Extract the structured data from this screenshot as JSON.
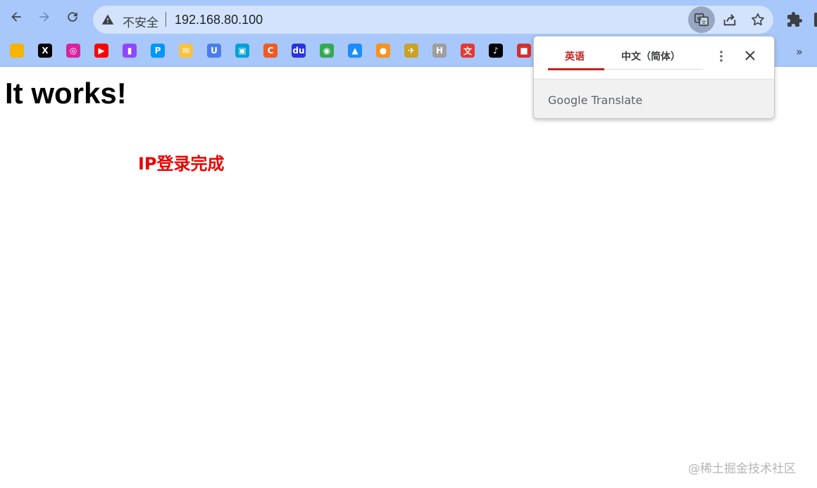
{
  "browser": {
    "security_label": "不安全",
    "url": "192.168.80.100",
    "bookmarks": [
      {
        "icon": "rainbow-bookmark-icon",
        "glyph": "",
        "color": "#f4b400"
      },
      {
        "icon": "x-twitter-bookmark-icon",
        "glyph": "X",
        "color": "#000000"
      },
      {
        "icon": "instagram-bookmark-icon",
        "glyph": "◎",
        "color": "#d6249f"
      },
      {
        "icon": "youtube-bookmark-icon",
        "glyph": "▶",
        "color": "#ff0000"
      },
      {
        "icon": "twitch-bookmark-icon",
        "glyph": "▮",
        "color": "#9146ff"
      },
      {
        "icon": "pixiv-bookmark-icon",
        "glyph": "P",
        "color": "#0096fa"
      },
      {
        "icon": "mail-bookmark-icon",
        "glyph": "✉",
        "color": "#f6c344"
      },
      {
        "icon": "colorful-bookmark-icon",
        "glyph": "U",
        "color": "#4a7cf0"
      },
      {
        "icon": "bilibili-bookmark-icon",
        "glyph": "▣",
        "color": "#00a1d6"
      },
      {
        "icon": "c-bookmark-icon",
        "glyph": "C",
        "color": "#f05a24"
      },
      {
        "icon": "baidu-bookmark-icon",
        "glyph": "du",
        "color": "#2932e1"
      },
      {
        "icon": "chrome-bookmark-icon",
        "glyph": "◉",
        "color": "#34a853"
      },
      {
        "icon": "drive-bookmark-icon",
        "glyph": "▲",
        "color": "#1a8cff"
      },
      {
        "icon": "video-bookmark-icon",
        "glyph": "●",
        "color": "#f7931e"
      },
      {
        "icon": "bird-bookmark-icon",
        "glyph": "✈",
        "color": "#c9a227"
      },
      {
        "icon": "h-bookmark-icon",
        "glyph": "H",
        "color": "#9e9e9e"
      },
      {
        "icon": "wen-bookmark-icon",
        "glyph": "文",
        "color": "#e53935"
      },
      {
        "icon": "tiktok-bookmark-icon",
        "glyph": "♪",
        "color": "#000000"
      },
      {
        "icon": "box-bookmark-icon",
        "glyph": "■",
        "color": "#d32f2f"
      }
    ]
  },
  "translate_popup": {
    "source_lang": "英语",
    "target_lang": "中文（简体）",
    "brand": "Google Translate"
  },
  "page": {
    "heading": "It works!",
    "status": "IP登录完成"
  },
  "watermark": "@稀土掘金技术社区"
}
